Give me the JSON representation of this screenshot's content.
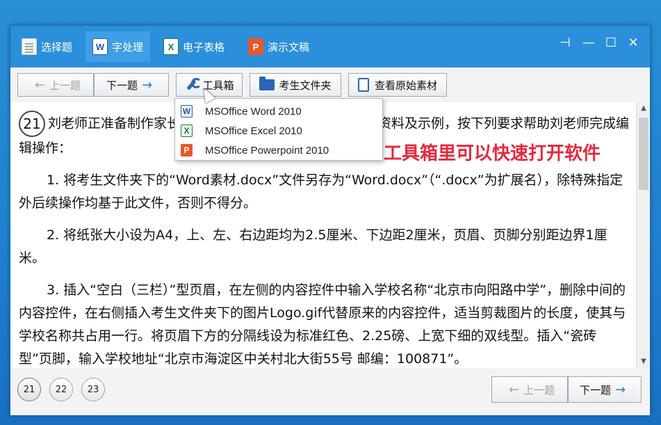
{
  "tabs": [
    {
      "label": "选择题",
      "icon": "document-icon"
    },
    {
      "label": "字处理",
      "icon": "word-icon",
      "active": true
    },
    {
      "label": "电子表格",
      "icon": "excel-icon"
    },
    {
      "label": "演示文稿",
      "icon": "powerpoint-icon"
    }
  ],
  "window_controls": {
    "pin": "⊣",
    "minimize": "—",
    "maximize": "☐",
    "close": "✕"
  },
  "toolbar": {
    "prev_label": "上一题",
    "next_label": "下一题",
    "toolbox_label": "工具箱",
    "exam_folder_label": "考生文件夹",
    "view_material_label": "查看原始素材"
  },
  "toolbox_menu": [
    {
      "label": "MSOffice Word 2010",
      "icon_letter": "W"
    },
    {
      "label": "MSOffice Excel 2010",
      "icon_letter": "X"
    },
    {
      "label": "MSOffice Powerpoint 2010",
      "icon_letter": "P"
    }
  ],
  "question": {
    "number": "21",
    "intro": "刘老师正准备制作家长会通知，根据考生文件夹下的相关资料及示例，按下列要求帮助刘老师完成编辑操作：",
    "items": [
      "1. 将考生文件夹下的“Word素材.docx”文件另存为“Word.docx”（“.docx”为扩展名），除特殊指定外后续操作均基于此文件，否则不得分。",
      "2. 将纸张大小设为A4，上、左、右边距均为2.5厘米、下边距2厘米，页眉、页脚分别距边界1厘米。",
      "3. 插入“空白（三栏）”型页眉，在左侧的内容控件中输入学校名称“北京市向阳路中学”，删除中间的内容控件，在右侧插入考生文件夹下的图片Logo.gif代替原来的内容控件，适当剪裁图片的长度，使其与学校名称共占用一行。将页眉下方的分隔线设为标准红色、2.25磅、上宽下细的双线型。插入“瓷砖型”页脚，输入学校地址“北京市海淀区中关村北大街55号 邮编：100871”。"
    ]
  },
  "annotation": "工具箱里可以快速打开软件",
  "question_nav": [
    "21",
    "22",
    "23"
  ],
  "current_question": "21",
  "bottom": {
    "prev_label": "上一题",
    "next_label": "下一题"
  },
  "colors": {
    "accent": "#1e86d8",
    "annotation": "#e8273b"
  }
}
